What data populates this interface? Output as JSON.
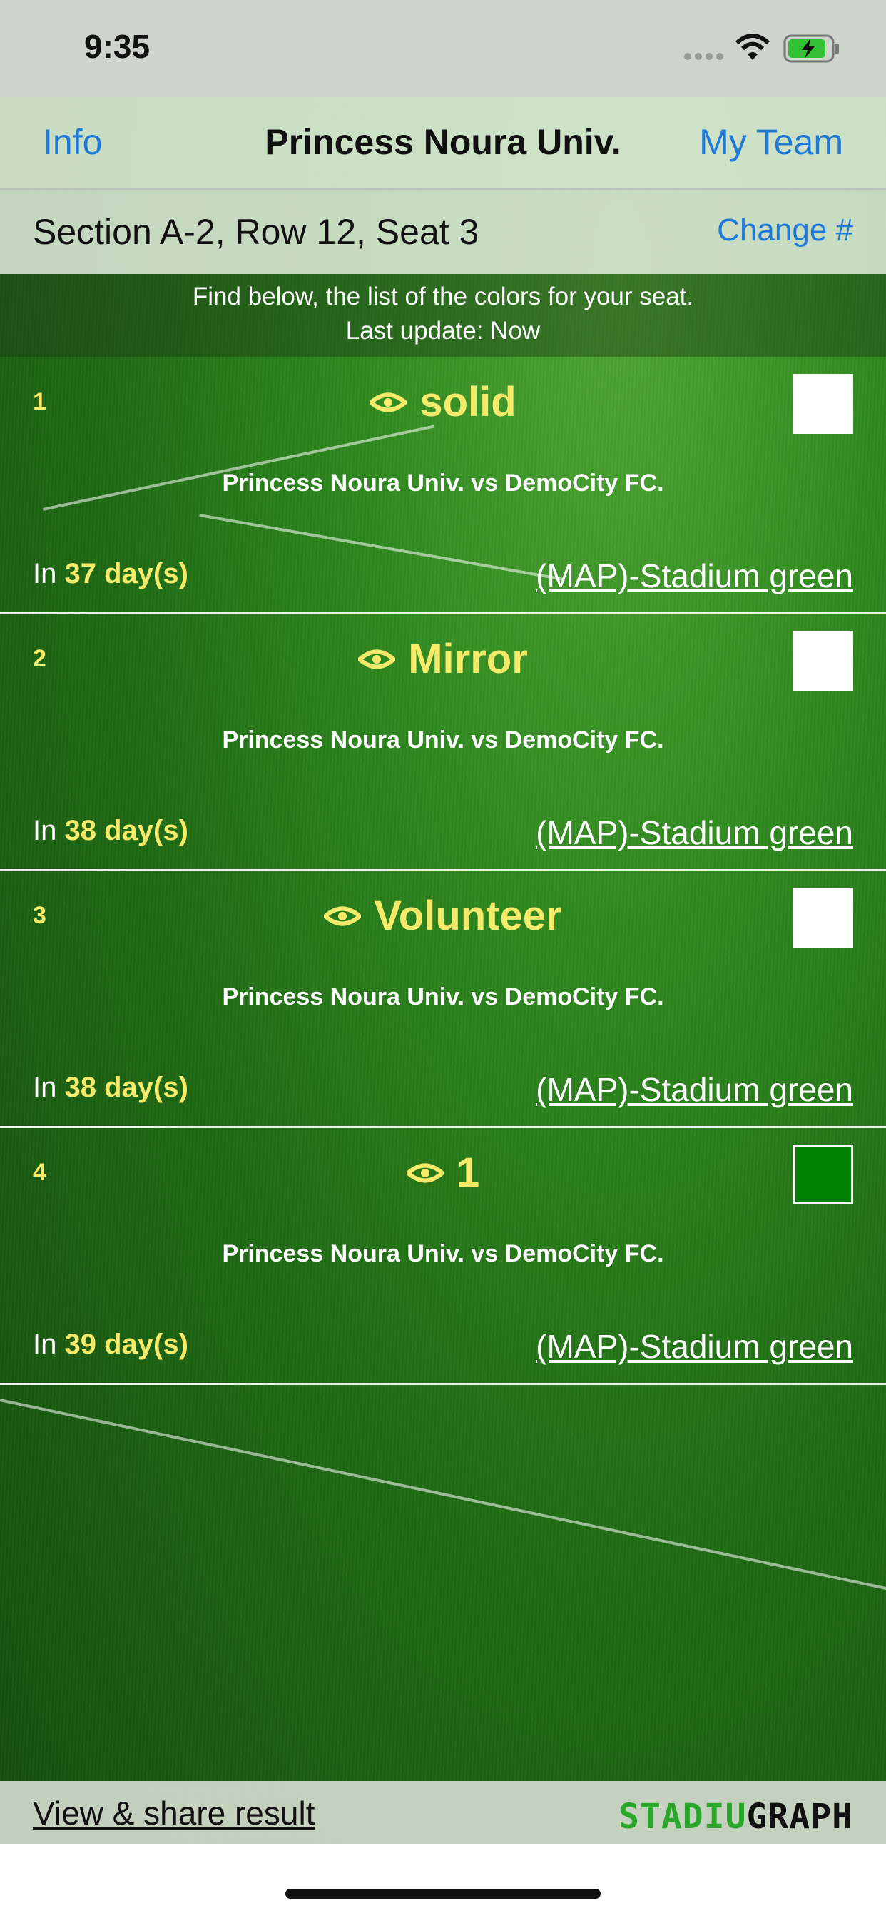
{
  "status": {
    "time": "9:35"
  },
  "nav": {
    "left": "Info",
    "title": "Princess Noura Univ.",
    "right": "My Team"
  },
  "seat": {
    "label": "Section A-2, Row 12, Seat 3",
    "change": "Change #"
  },
  "notice": {
    "line1": "Find below, the list of the colors for your seat.",
    "line2": "Last update: Now"
  },
  "cards": [
    {
      "num": "1",
      "title": "solid",
      "swatch": "#ffffff",
      "match": "Princess Noura Univ. vs DemoCity FC.",
      "in": "In",
      "days": "37 day(s)",
      "map": "(MAP)-Stadium green"
    },
    {
      "num": "2",
      "title": "Mirror",
      "swatch": "#ffffff",
      "match": "Princess Noura Univ. vs DemoCity FC.",
      "in": "In",
      "days": "38 day(s)",
      "map": "(MAP)-Stadium green"
    },
    {
      "num": "3",
      "title": "Volunteer",
      "swatch": "#ffffff",
      "match": "Princess Noura Univ. vs DemoCity FC.",
      "in": "In",
      "days": "38 day(s)",
      "map": "(MAP)-Stadium green"
    },
    {
      "num": "4",
      "title": "1",
      "swatch": "#008000",
      "match": "Princess Noura Univ. vs DemoCity FC.",
      "in": "In",
      "days": "39 day(s)",
      "map": "(MAP)-Stadium green"
    }
  ],
  "bottom": {
    "share": "View & share result",
    "logo_a": "STADIU",
    "logo_b": "GRAPH"
  },
  "colors": {
    "accent": "#1e7ad8",
    "highlight": "#f5ea6a"
  }
}
